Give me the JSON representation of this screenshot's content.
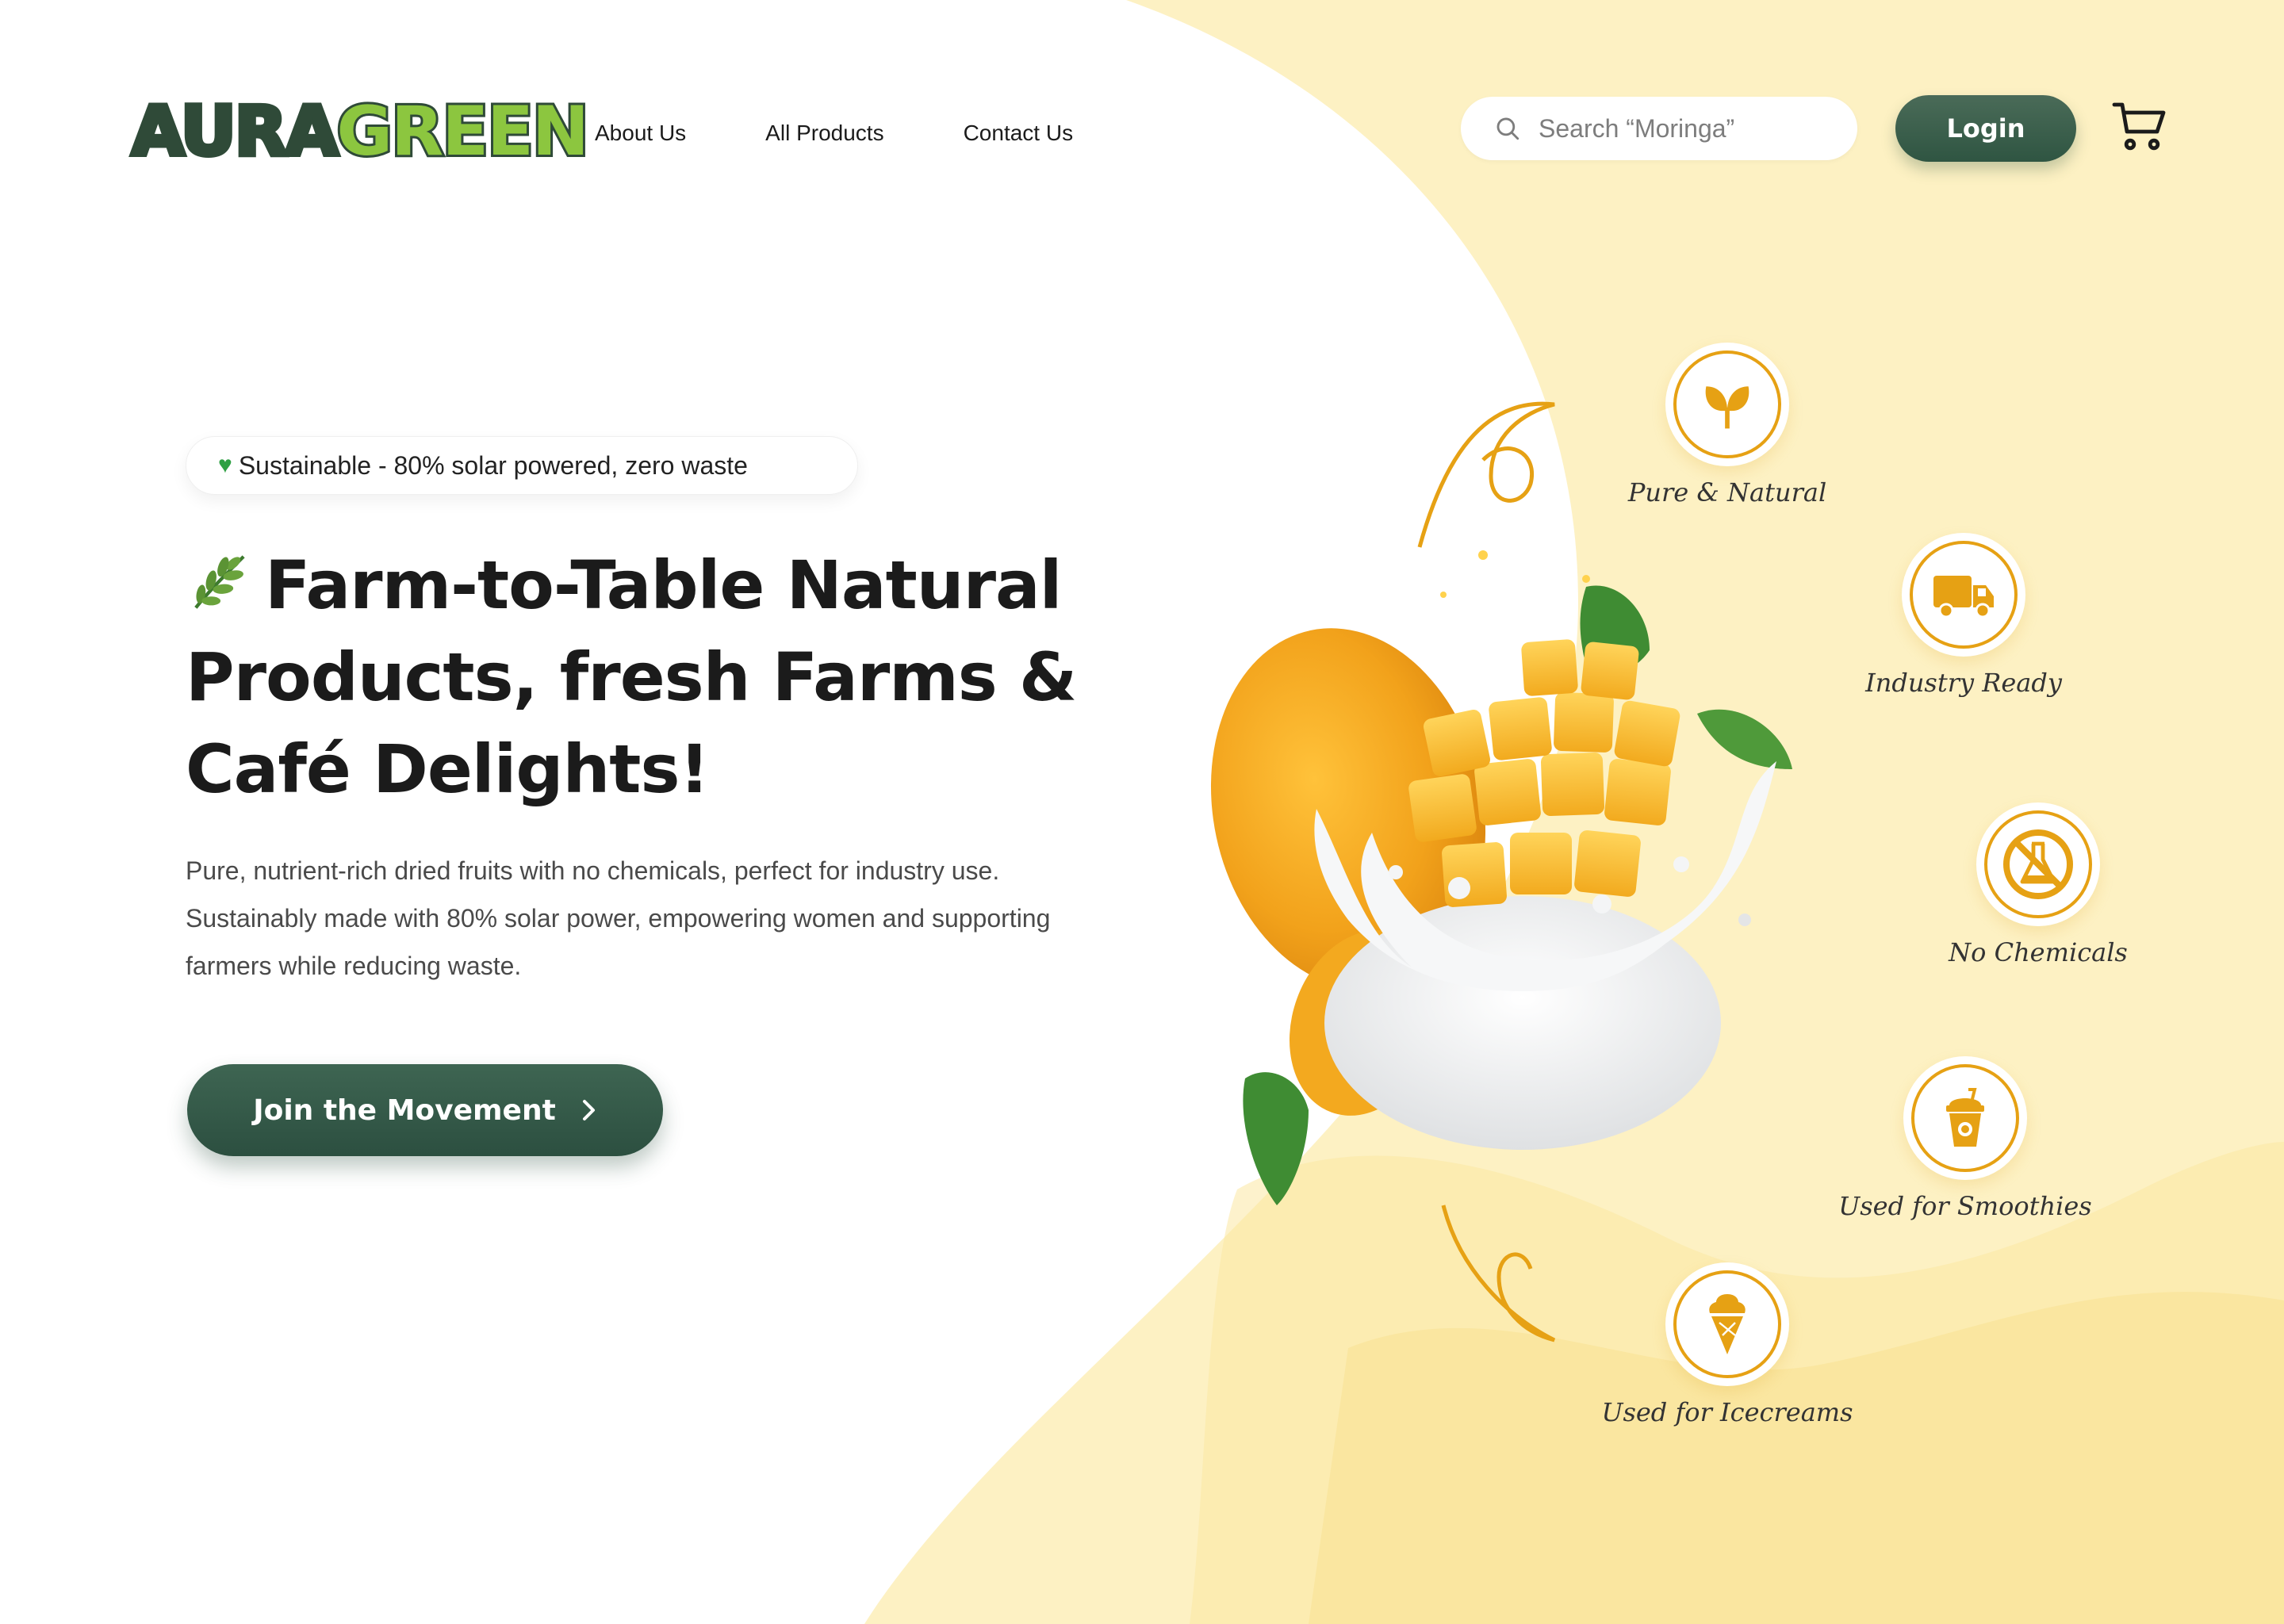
{
  "brand": {
    "name_part1": "AURA",
    "name_part2": "GREEN"
  },
  "nav": {
    "items": [
      "About Us",
      "All Products",
      "Contact Us"
    ]
  },
  "search": {
    "placeholder": "Search “Moringa”"
  },
  "header": {
    "login_label": "Login"
  },
  "hero": {
    "badge": "Sustainable - 80% solar powered, zero waste",
    "title": "Farm-to-Table Natural Products, fresh Farms & Café Delights!",
    "description": "Pure, nutrient-rich dried fruits with no chemicals, perfect for industry use. Sustainably made with 80% solar power, empowering women and supporting farmers while reducing waste.",
    "cta_label": "Join the Movement"
  },
  "features": [
    {
      "label": "Pure & Natural",
      "icon": "sprout-icon"
    },
    {
      "label": "Industry Ready",
      "icon": "truck-icon"
    },
    {
      "label": "No Chemicals",
      "icon": "no-chemicals-icon"
    },
    {
      "label": "Used for Smoothies",
      "icon": "smoothie-cup-icon"
    },
    {
      "label": "Used for Icecreams",
      "icon": "ice-cream-icon"
    }
  ],
  "colors": {
    "brand_green": "#2f5542",
    "accent_yellow": "#fdf1c3",
    "icon_orange": "#e6a114",
    "logo_lime": "#8cc63f"
  }
}
